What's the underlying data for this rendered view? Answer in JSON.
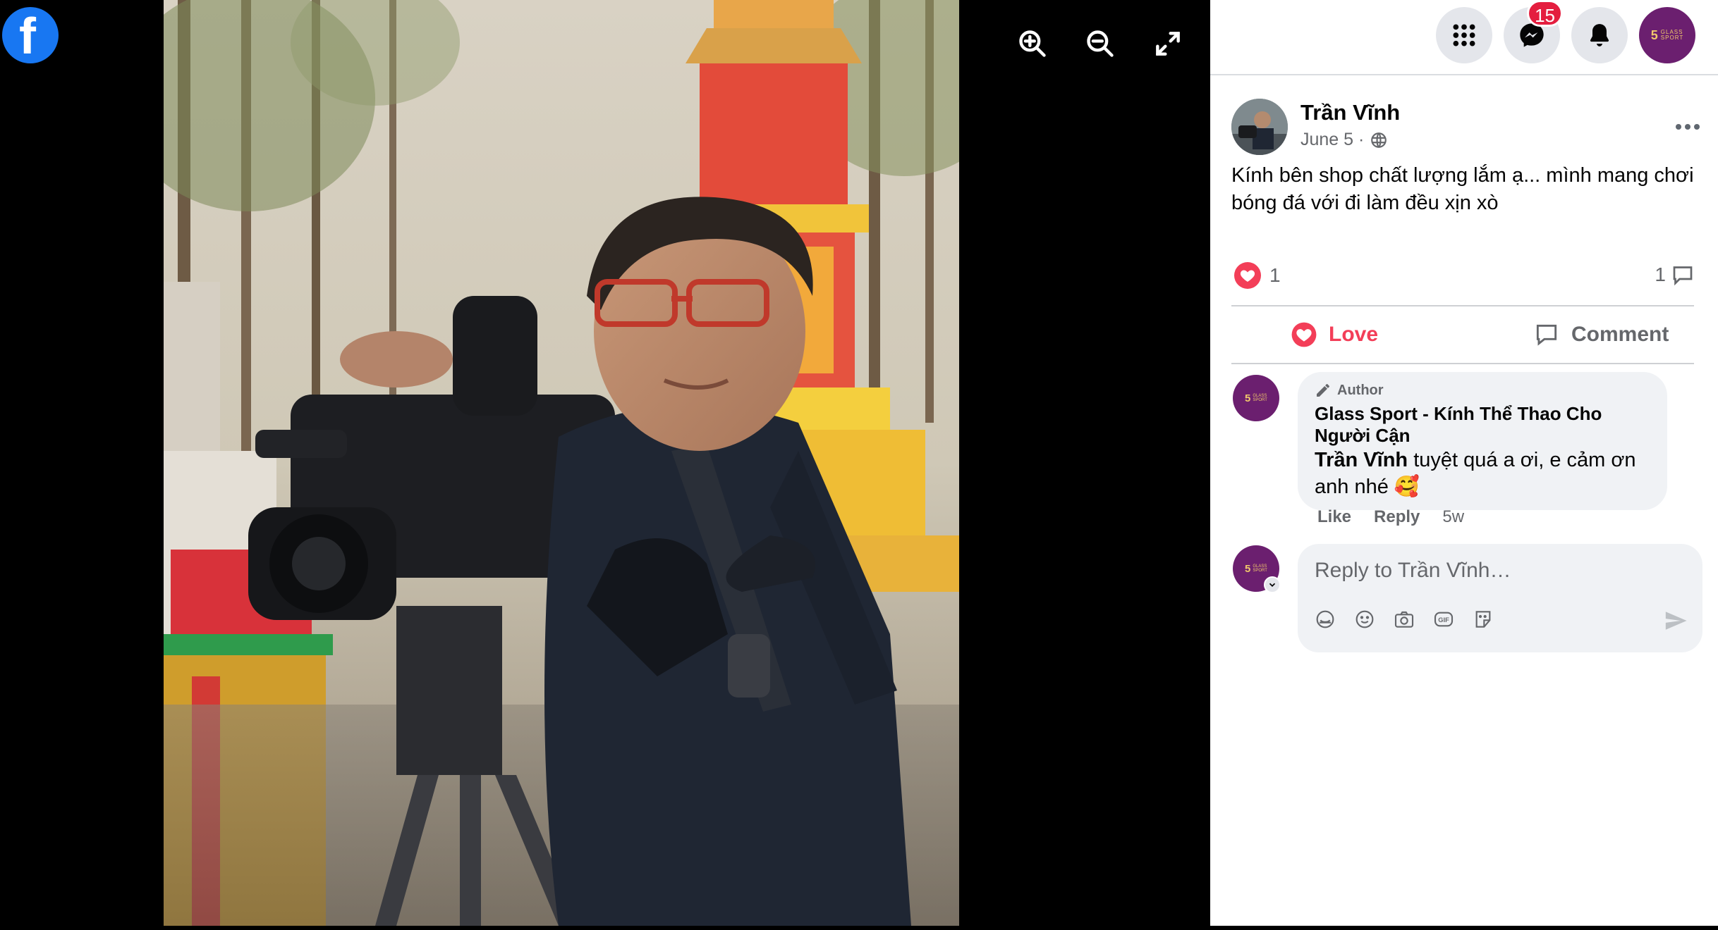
{
  "viewer": {
    "logo_letter": "f",
    "tools": [
      "zoom-in",
      "zoom-out",
      "fullscreen"
    ]
  },
  "topnav": {
    "messenger_badge": "15"
  },
  "brand": {
    "mark": "5",
    "text_line1": "GLASS",
    "text_line2": "SPORT",
    "color": "#6b1f6f"
  },
  "post": {
    "author": "Trần Vĩnh",
    "date": "June 5 ·",
    "text": "Kính bên shop chất lượng lắm ạ... mình mang chơi bóng đá với đi làm đều xịn xò",
    "reaction_count": "1",
    "comment_count": "1",
    "love_label": "Love",
    "comment_label": "Comment"
  },
  "comment": {
    "tag": "Author",
    "name": "Glass Sport - Kính Thể Thao Cho Người Cận",
    "mention": "Trần Vĩnh",
    "text": " tuyệt quá a ơi, e cảm ơn anh nhé 🥰",
    "like_label": "Like",
    "reply_label": "Reply",
    "time": "5w"
  },
  "reply": {
    "placeholder": "Reply to Trần Vĩnh…"
  },
  "colors": {
    "facebook_blue": "#1877f2",
    "love_red": "#f33e58",
    "badge_red": "#e41e3f"
  }
}
